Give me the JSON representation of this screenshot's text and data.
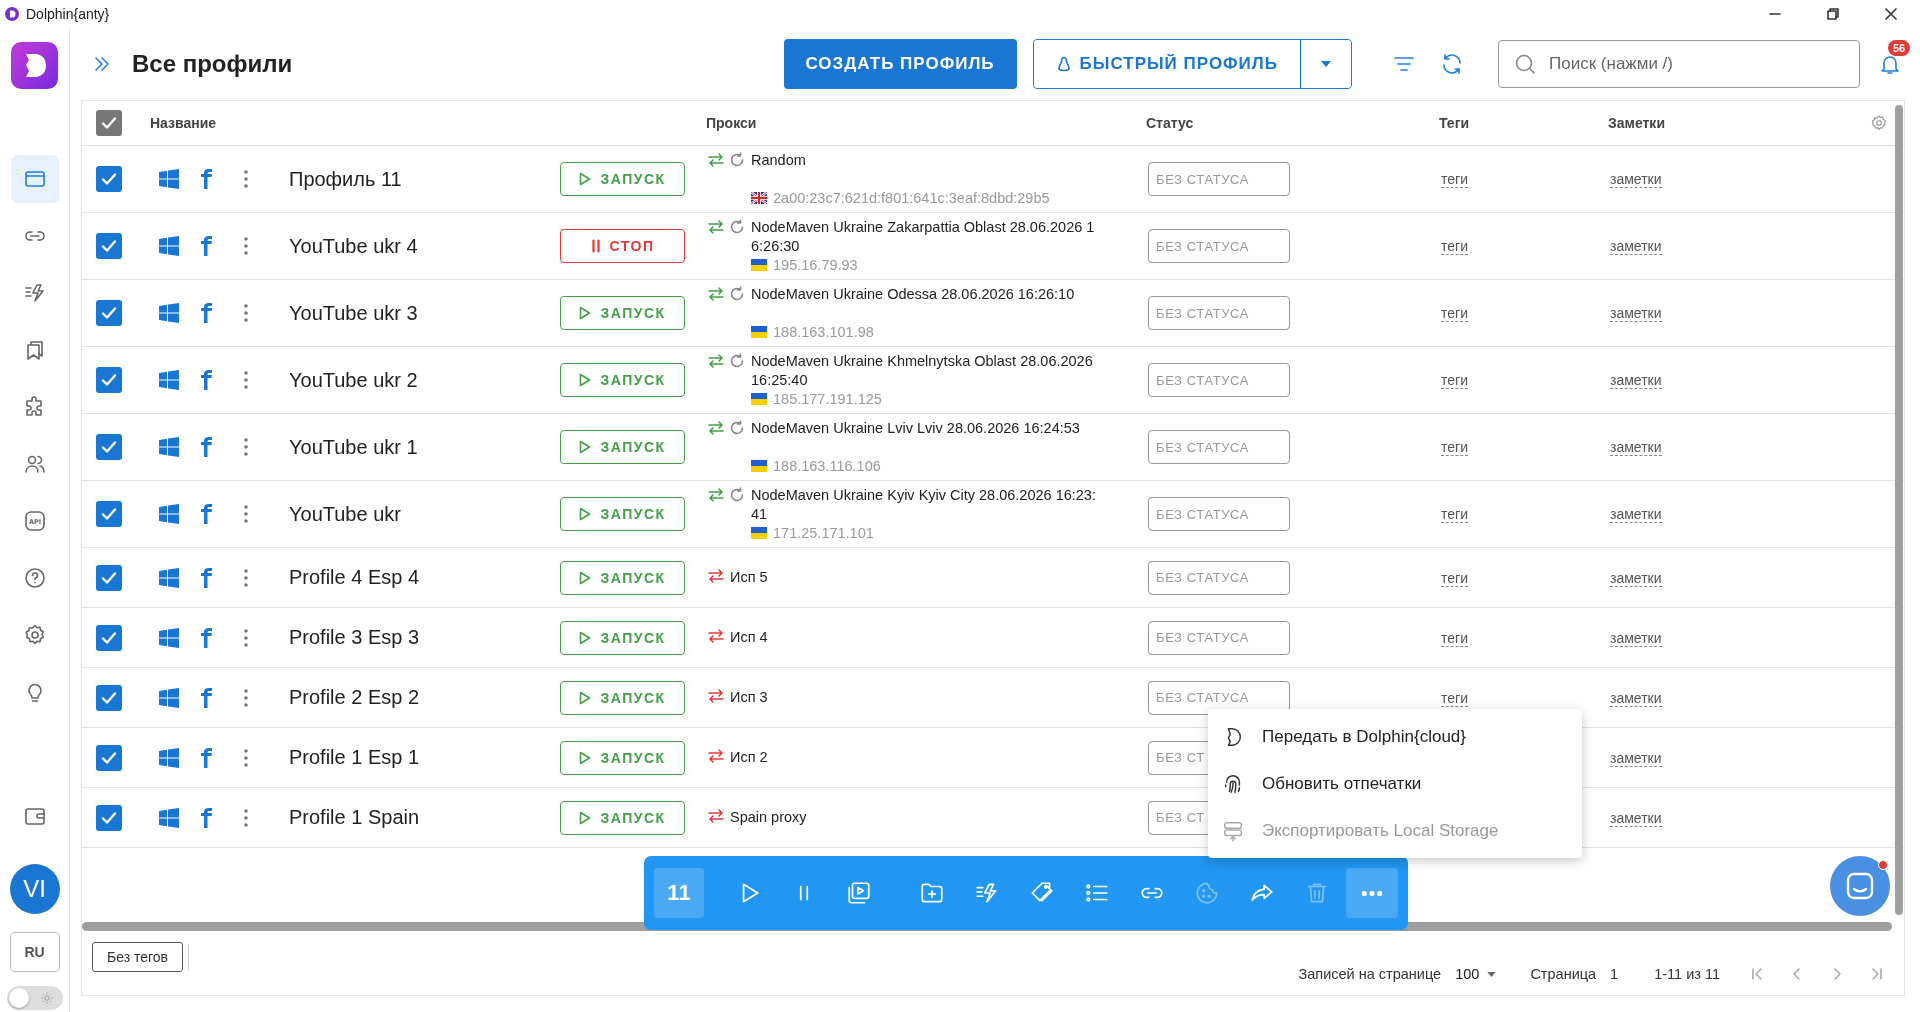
{
  "window": {
    "title": "Dolphin{anty}"
  },
  "sidebar": {
    "items": [
      {
        "selected": true
      },
      {
        "selected": false
      },
      {
        "selected": false
      },
      {
        "selected": false
      },
      {
        "selected": false
      },
      {
        "selected": false
      },
      {
        "selected": false,
        "label": "API"
      },
      {
        "selected": false
      },
      {
        "selected": false
      },
      {
        "selected": false
      }
    ],
    "avatar": "VI",
    "language": "RU",
    "theme_toggle": {
      "on": false
    }
  },
  "header": {
    "title": "Все профили",
    "create_button": "СОЗДАТЬ ПРОФИЛЬ",
    "quick_button": "БЫСТРЫЙ ПРОФИЛЬ",
    "search": {
      "placeholder": "Поиск (нажми /)"
    },
    "notifications": "56"
  },
  "table": {
    "select_all": {
      "checked": true
    },
    "columns": [
      "Название",
      "Прокси",
      "Статус",
      "Теги",
      "Заметки"
    ],
    "rows": [
      {
        "checked": true,
        "name": "Профиль 11",
        "action": {
          "kind": "start",
          "label": "ЗАПУСК"
        },
        "proxy": {
          "kind": "rotating",
          "name": "Random",
          "ip": {
            "kind": "gb",
            "value": "2a00:23c7:621d:f801:641c:3eaf:8dbd:29b5"
          }
        },
        "status": "БЕЗ СТАТУСА",
        "tags": "теги",
        "notes": "заметки"
      },
      {
        "checked": true,
        "name": "YouTube ukr 4",
        "action": {
          "kind": "stop",
          "label": "СТОП"
        },
        "proxy": {
          "kind": "rotating",
          "name": "NodeMaven Ukraine Zakarpattia Oblast 28.06.2026 16:26:30",
          "ip": {
            "kind": "ua",
            "value": "195.16.79.93"
          }
        },
        "status": "БЕЗ СТАТУСА",
        "tags": "теги",
        "notes": "заметки"
      },
      {
        "checked": true,
        "name": "YouTube ukr 3",
        "action": {
          "kind": "start",
          "label": "ЗАПУСК"
        },
        "proxy": {
          "kind": "rotating",
          "name": "NodeMaven Ukraine Odessa 28.06.2026 16:26:10",
          "ip": {
            "kind": "ua",
            "value": "188.163.101.98"
          }
        },
        "status": "БЕЗ СТАТУСА",
        "tags": "теги",
        "notes": "заметки"
      },
      {
        "checked": true,
        "name": "YouTube ukr 2",
        "action": {
          "kind": "start",
          "label": "ЗАПУСК"
        },
        "proxy": {
          "kind": "rotating",
          "name": "NodeMaven Ukraine Khmelnytska Oblast 28.06.2026 16:25:40",
          "ip": {
            "kind": "ua",
            "value": "185.177.191.125"
          }
        },
        "status": "БЕЗ СТАТУСА",
        "tags": "теги",
        "notes": "заметки"
      },
      {
        "checked": true,
        "name": "YouTube ukr 1",
        "action": {
          "kind": "start",
          "label": "ЗАПУСК"
        },
        "proxy": {
          "kind": "rotating",
          "name": "NodeMaven Ukraine Lviv Lviv 28.06.2026 16:24:53",
          "ip": {
            "kind": "ua",
            "value": "188.163.116.106"
          }
        },
        "status": "БЕЗ СТАТУСА",
        "tags": "теги",
        "notes": "заметки"
      },
      {
        "checked": true,
        "name": "YouTube ukr",
        "action": {
          "kind": "start",
          "label": "ЗАПУСК"
        },
        "proxy": {
          "kind": "rotating",
          "name": "NodeMaven Ukraine Kyiv Kyiv City 28.06.2026 16:23:41",
          "ip": {
            "kind": "ua",
            "value": "171.25.171.101"
          }
        },
        "status": "БЕЗ СТАТУСА",
        "tags": "теги",
        "notes": "заметки"
      },
      {
        "checked": true,
        "name": "Profile 4 Esp 4",
        "action": {
          "kind": "start",
          "label": "ЗАПУСК"
        },
        "proxy": {
          "kind": "static",
          "name": "Исп 5"
        },
        "status": "БЕЗ СТАТУСА",
        "tags": "теги",
        "notes": "заметки"
      },
      {
        "checked": true,
        "name": "Profile 3 Esp 3",
        "action": {
          "kind": "start",
          "label": "ЗАПУСК"
        },
        "proxy": {
          "kind": "static",
          "name": "Исп 4"
        },
        "status": "БЕЗ СТАТУСА",
        "tags": "теги",
        "notes": "заметки"
      },
      {
        "checked": true,
        "name": "Profile 2 Esp 2",
        "action": {
          "kind": "start",
          "label": "ЗАПУСК"
        },
        "proxy": {
          "kind": "static",
          "name": "Исп 3"
        },
        "status": "БЕЗ СТАТУСА",
        "tags": "теги",
        "notes": "заметки"
      },
      {
        "checked": true,
        "name": "Profile 1 Esp 1",
        "action": {
          "kind": "start",
          "label": "ЗАПУСК"
        },
        "proxy": {
          "kind": "static",
          "name": "Исп 2"
        },
        "status": "БЕЗ СТ",
        "notes": "заметки"
      },
      {
        "checked": true,
        "name": "Profile 1 Spain",
        "action": {
          "kind": "start",
          "label": "ЗАПУСК"
        },
        "proxy": {
          "kind": "static",
          "name": "Spain proxy"
        },
        "status": "БЕЗ СТ",
        "notes": "заметки"
      }
    ]
  },
  "bulk_toolbar": {
    "count": "11",
    "buttons": [
      {
        "disabled": false,
        "selected": false
      },
      {
        "disabled": false,
        "selected": false
      },
      {
        "disabled": false,
        "selected": false
      },
      {
        "disabled": false,
        "selected": false
      },
      {
        "disabled": false,
        "selected": false
      },
      {
        "disabled": false,
        "selected": false
      },
      {
        "disabled": false,
        "selected": false
      },
      {
        "disabled": false,
        "selected": false
      },
      {
        "disabled": true,
        "selected": false
      },
      {
        "disabled": false,
        "selected": false
      },
      {
        "disabled": true,
        "selected": false
      },
      {
        "disabled": false,
        "selected": true
      }
    ]
  },
  "context_menu": {
    "items": [
      {
        "label": "Передать в Dolphin{cloud}",
        "disabled": false
      },
      {
        "label": "Обновить отпечатки",
        "disabled": false
      },
      {
        "label": "Экспортировать Local Storage",
        "disabled": true
      }
    ]
  },
  "footer": {
    "tag_filter": "Без тегов",
    "per_page_label": "Записей на странице",
    "per_page": "100",
    "page_label": "Страница",
    "page": "1",
    "range": "1-11 из 11"
  }
}
